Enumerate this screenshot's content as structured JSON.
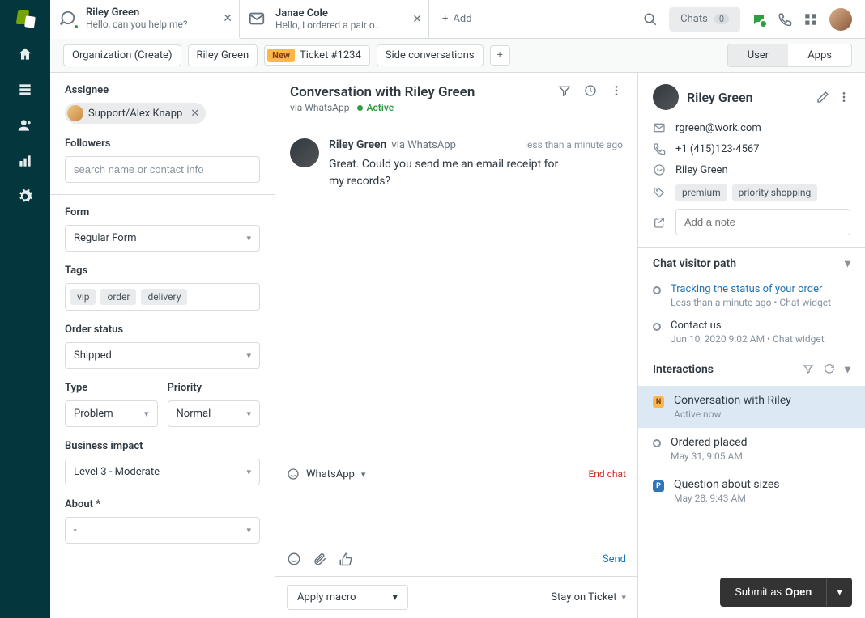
{
  "tabs": [
    {
      "title": "Riley Green",
      "subtitle": "Hello, can you help me?",
      "icon": "chat"
    },
    {
      "title": "Janae Cole",
      "subtitle": "Hello, I ordered a pair o...",
      "icon": "mail"
    }
  ],
  "add_label": "Add",
  "top_chat": {
    "label": "Chats",
    "count": "0"
  },
  "pills": {
    "org": "Organization (Create)",
    "requester": "Riley Green",
    "new": "New",
    "ticket": "Ticket #1234",
    "side": "Side conversations"
  },
  "segment": {
    "user": "User",
    "apps": "Apps"
  },
  "left": {
    "assignee_label": "Assignee",
    "assignee_value": "Support/Alex Knapp",
    "followers_label": "Followers",
    "followers_placeholder": "search name or contact info",
    "form_label": "Form",
    "form_value": "Regular Form",
    "tags_label": "Tags",
    "tags": [
      "vip",
      "order",
      "delivery"
    ],
    "order_status_label": "Order status",
    "order_status_value": "Shipped",
    "type_label": "Type",
    "type_value": "Problem",
    "priority_label": "Priority",
    "priority_value": "Normal",
    "impact_label": "Business impact",
    "impact_value": "Level 3 - Moderate",
    "about_label": "About *",
    "about_value": "-"
  },
  "conversation": {
    "title": "Conversation with Riley Green",
    "via": "via WhatsApp",
    "status": "Active",
    "message_name": "Riley Green",
    "message_via": "via WhatsApp",
    "message_time": "less than a minute ago",
    "message_text": "Great. Could you send me an email receipt for my records?",
    "channel": "WhatsApp",
    "end_chat": "End chat",
    "send": "Send",
    "macro": "Apply macro",
    "stay": "Stay on Ticket"
  },
  "profile": {
    "name": "Riley Green",
    "email": "rgreen@work.com",
    "phone": "+1 (415)123-4567",
    "wa": "Riley Green",
    "tags": [
      "premium",
      "priority shopping"
    ],
    "note_placeholder": "Add a note"
  },
  "visitor_path": {
    "title": "Chat visitor path",
    "items": [
      {
        "title": "Tracking the status of your order",
        "sub": "Less than a minute ago • Chat widget",
        "link": true
      },
      {
        "title": "Contact us",
        "sub": "Jun 10, 2020 9:02 AM • Chat widget",
        "link": false
      }
    ]
  },
  "interactions": {
    "title": "Interactions",
    "items": [
      {
        "badge": "N",
        "title": "Conversation with Riley",
        "sub": "Active now",
        "active": true
      },
      {
        "badge": "",
        "title": "Ordered placed",
        "sub": "May 31, 9:05 AM"
      },
      {
        "badge": "P",
        "title": "Question about sizes",
        "sub": "May 28, 9:43 AM"
      }
    ]
  },
  "submit": {
    "prefix": "Submit as ",
    "status": "Open"
  }
}
